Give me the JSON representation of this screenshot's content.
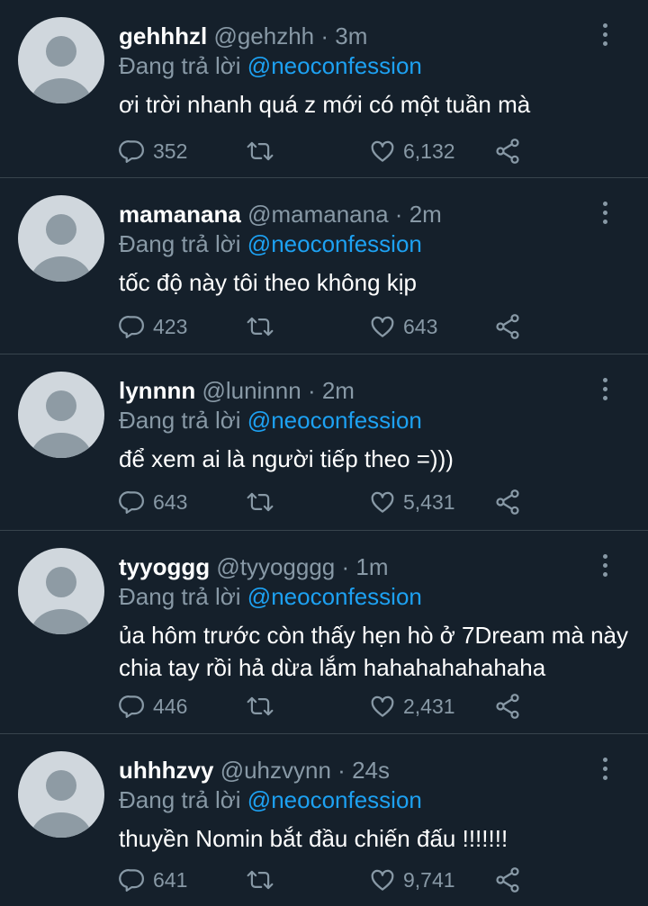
{
  "reply_prefix": "Đang trả lời",
  "tweets": [
    {
      "name": "gehhhzl",
      "handle": "@gehzhh",
      "time": "3m",
      "reply_to": "@neoconfession",
      "text": "ơi trời nhanh quá z mới có một tuần mà",
      "replies": "352",
      "likes": "6,132"
    },
    {
      "name": "mamanana",
      "handle": "@mamanana",
      "time": "2m",
      "reply_to": "@neoconfession",
      "text": "tốc độ này tôi theo không kịp",
      "replies": "423",
      "likes": "643"
    },
    {
      "name": "lynnnn",
      "handle": "@luninnn",
      "time": "2m",
      "reply_to": "@neoconfession",
      "text": "để xem ai là người tiếp theo =)))",
      "replies": "643",
      "likes": "5,431"
    },
    {
      "name": "tyyoggg",
      "handle": "@tyyogggg",
      "time": "1m",
      "reply_to": "@neoconfession",
      "text": "ủa hôm trước còn thấy hẹn hò ở 7Dream mà này chia tay rồi hả dừa lắm hahahahahahaha",
      "replies": "446",
      "likes": "2,431"
    },
    {
      "name": "uhhhzvy",
      "handle": "@uhzvynn",
      "time": "24s",
      "reply_to": "@neoconfession",
      "text": "thuyền Nomin bắt đầu chiến đấu !!!!!!!",
      "replies": "641",
      "likes": "9,741"
    }
  ],
  "icons": {
    "reply": "reply-icon",
    "retweet": "retweet-icon",
    "like": "heart-icon",
    "share": "share-icon",
    "more": "more-vertical-icon",
    "avatar": "default-avatar-icon"
  },
  "colors": {
    "background": "#15202b",
    "text": "#ffffff",
    "secondary": "#8899a6",
    "accent": "#1da1f2",
    "divider": "#38444d"
  }
}
